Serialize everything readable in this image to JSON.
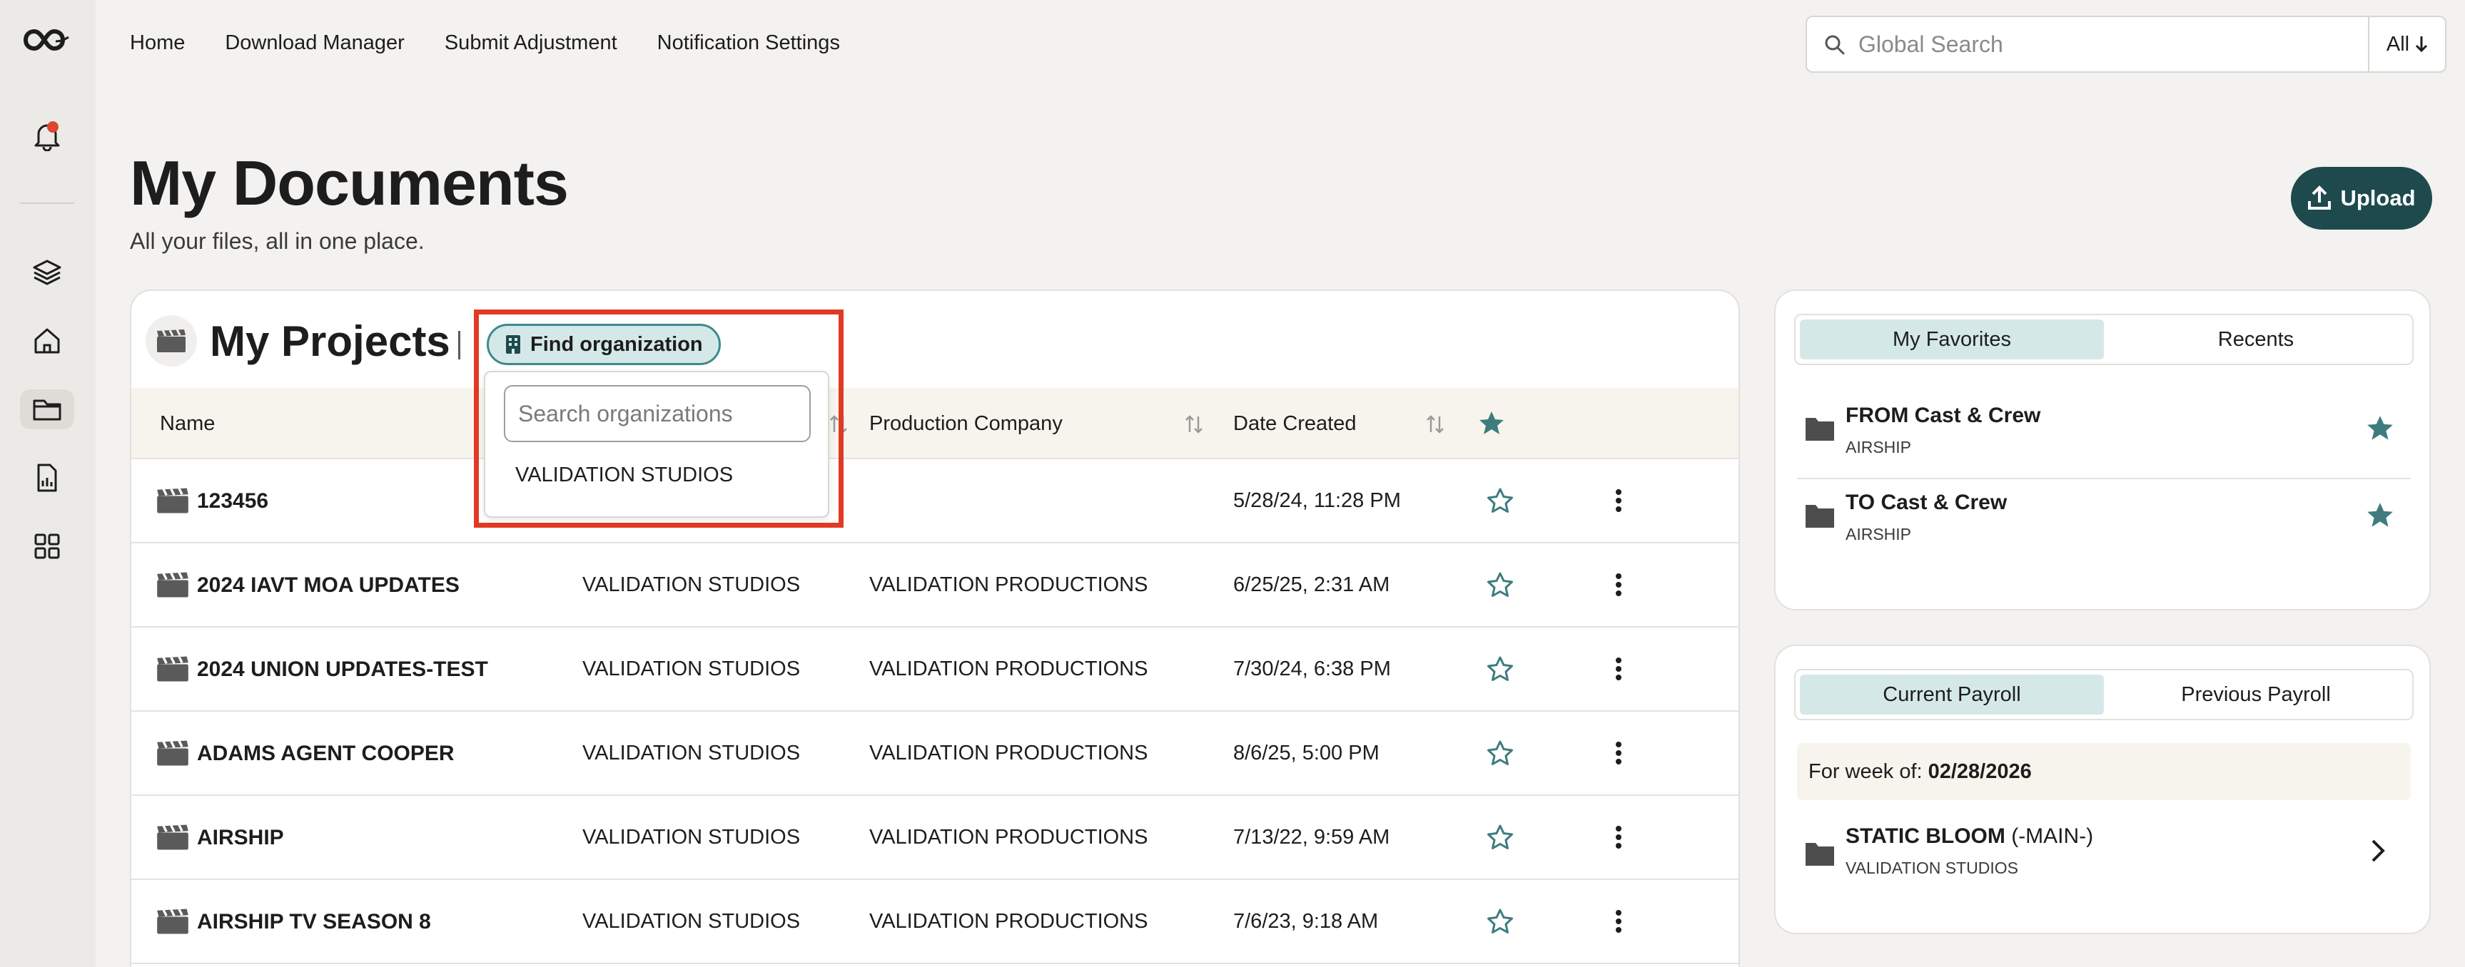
{
  "nav": {
    "items": [
      "Home",
      "Download Manager",
      "Submit Adjustment",
      "Notification Settings"
    ]
  },
  "search": {
    "placeholder": "Global Search",
    "scope": "All"
  },
  "header": {
    "title": "My Documents",
    "subtitle": "All your files, all in one place.",
    "upload_label": "Upload"
  },
  "projects": {
    "title": "My Projects",
    "find_org_label": "Find organization",
    "org_search_placeholder": "Search organizations",
    "org_options": [
      "VALIDATION STUDIOS"
    ],
    "columns": {
      "name": "Name",
      "production_company": "Production Company",
      "date_created": "Date Created"
    },
    "rows": [
      {
        "name": "123456",
        "org": "",
        "prod": "",
        "date": "5/28/24, 11:28 PM"
      },
      {
        "name": "2024 IAVT MOA UPDATES",
        "org": "VALIDATION STUDIOS",
        "prod": "VALIDATION PRODUCTIONS",
        "date": "6/25/25, 2:31 AM"
      },
      {
        "name": "2024 UNION UPDATES-TEST",
        "org": "VALIDATION STUDIOS",
        "prod": "VALIDATION PRODUCTIONS",
        "date": "7/30/24, 6:38 PM"
      },
      {
        "name": "ADAMS AGENT COOPER",
        "org": "VALIDATION STUDIOS",
        "prod": "VALIDATION PRODUCTIONS",
        "date": "8/6/25, 5:00 PM"
      },
      {
        "name": "AIRSHIP",
        "org": "VALIDATION STUDIOS",
        "prod": "VALIDATION PRODUCTIONS",
        "date": "7/13/22, 9:59 AM"
      },
      {
        "name": "AIRSHIP TV SEASON 8",
        "org": "VALIDATION STUDIOS",
        "prod": "VALIDATION PRODUCTIONS",
        "date": "7/6/23, 9:18 AM"
      }
    ]
  },
  "favorites": {
    "tabs": [
      "My Favorites",
      "Recents"
    ],
    "items": [
      {
        "title": "FROM Cast & Crew",
        "subtitle": "AIRSHIP"
      },
      {
        "title": "TO Cast & Crew",
        "subtitle": "AIRSHIP"
      }
    ]
  },
  "payroll": {
    "tabs": [
      "Current Payroll",
      "Previous Payroll"
    ],
    "week_label": "For week of:",
    "week_date": "02/28/2026",
    "item_title": "STATIC BLOOM",
    "item_suffix": "(-MAIN-)",
    "item_subtitle": "VALIDATION STUDIOS"
  },
  "colors": {
    "accent": "#1e4a4d",
    "highlight": "#e03a24",
    "selected_tab": "#d5e8e8",
    "star": "#3f7c7e"
  }
}
